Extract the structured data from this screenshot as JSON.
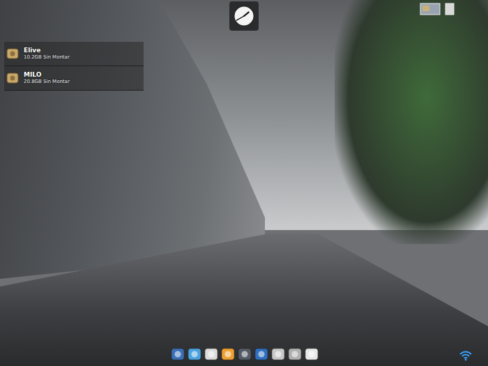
{
  "devices": [
    {
      "name": "Elive",
      "status": "10.2GB Sin Montar"
    },
    {
      "name": "MILO",
      "status": "20.8GB Sin Montar"
    }
  ],
  "clock": {
    "hour": 1,
    "minute": 40
  }
}
